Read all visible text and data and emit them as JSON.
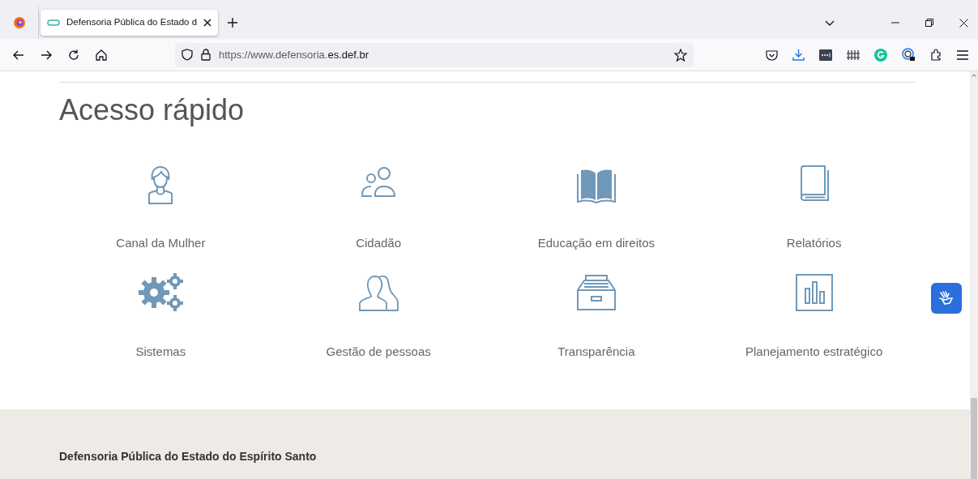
{
  "browser": {
    "tab": {
      "title": "Defensoria Pública do Estado d",
      "selected": true
    },
    "url_prefix": "https://www.defensoria.",
    "url_domain": "es.def.br"
  },
  "page": {
    "heading": "Acesso rápido",
    "links": [
      {
        "label": "Canal da Mulher"
      },
      {
        "label": "Cidadão"
      },
      {
        "label": "Educação em direitos"
      },
      {
        "label": "Relatórios"
      },
      {
        "label": "Sistemas"
      },
      {
        "label": "Gestão de pessoas"
      },
      {
        "label": "Transparência"
      },
      {
        "label": "Planejamento estratégico"
      }
    ],
    "footer": {
      "title": "Defensoria Pública do Estado do Espírito Santo"
    }
  }
}
